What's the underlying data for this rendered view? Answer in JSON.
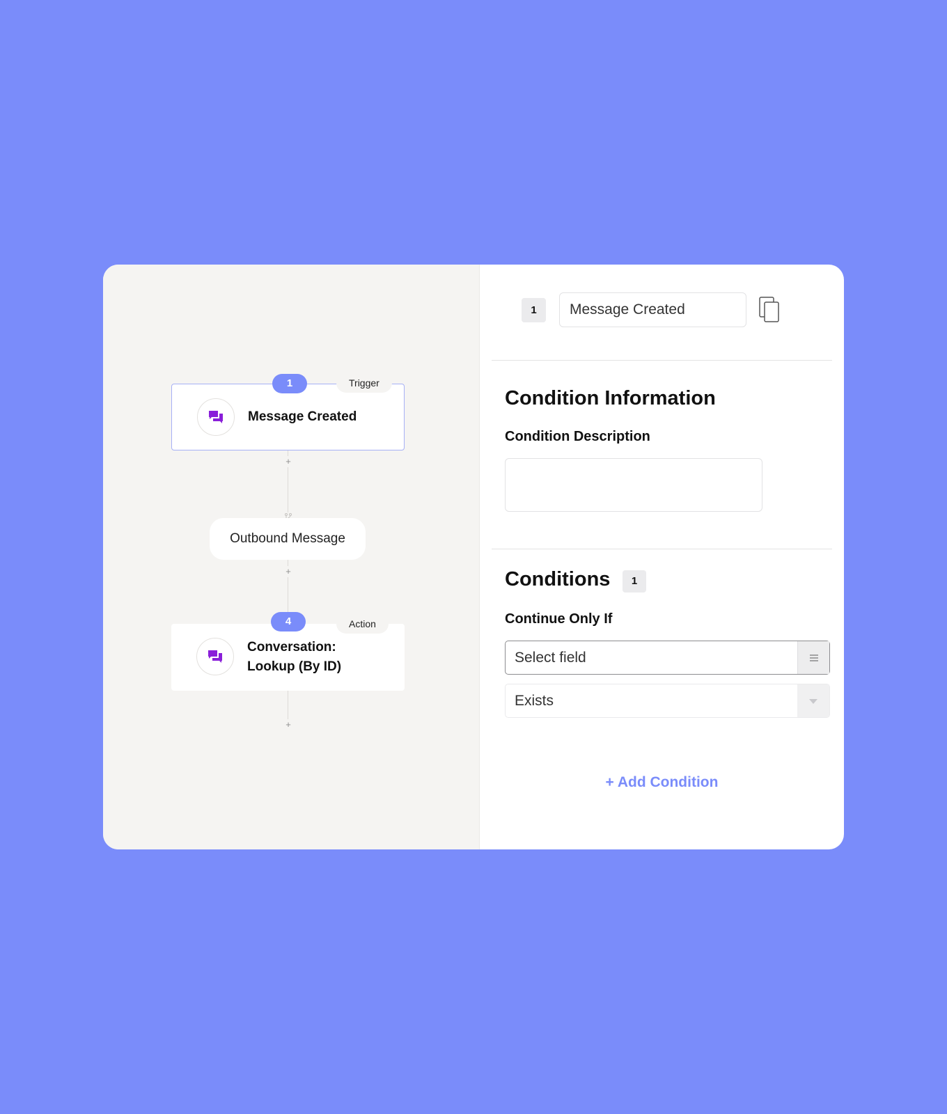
{
  "workflow": {
    "trigger_node": {
      "step": "1",
      "type": "Trigger",
      "title": "Message Created",
      "icon": "chat-bubbles-icon"
    },
    "filter_node": {
      "title": "Outbound Message",
      "icon": "branch-icon"
    },
    "action_node": {
      "step": "4",
      "type": "Action",
      "title_line1": "Conversation:",
      "title_line2": "Lookup (By ID)",
      "icon": "chat-bubbles-icon"
    },
    "add_step_symbol": "+"
  },
  "panel": {
    "step_number": "1",
    "step_name": "Message Created",
    "copy_icon": "copy-icon",
    "condition_info_heading": "Condition Information",
    "condition_description_label": "Condition Description",
    "condition_description_value": "",
    "conditions_heading": "Conditions",
    "conditions_count": "1",
    "continue_label": "Continue Only If",
    "field_select_value": "Select field",
    "operator_select_value": "Exists",
    "add_condition_label": "+ Add Condition"
  },
  "colors": {
    "accent": "#7a8cfa",
    "icon_purple": "#8a1fd9",
    "canvas_bg": "#f5f4f2"
  }
}
